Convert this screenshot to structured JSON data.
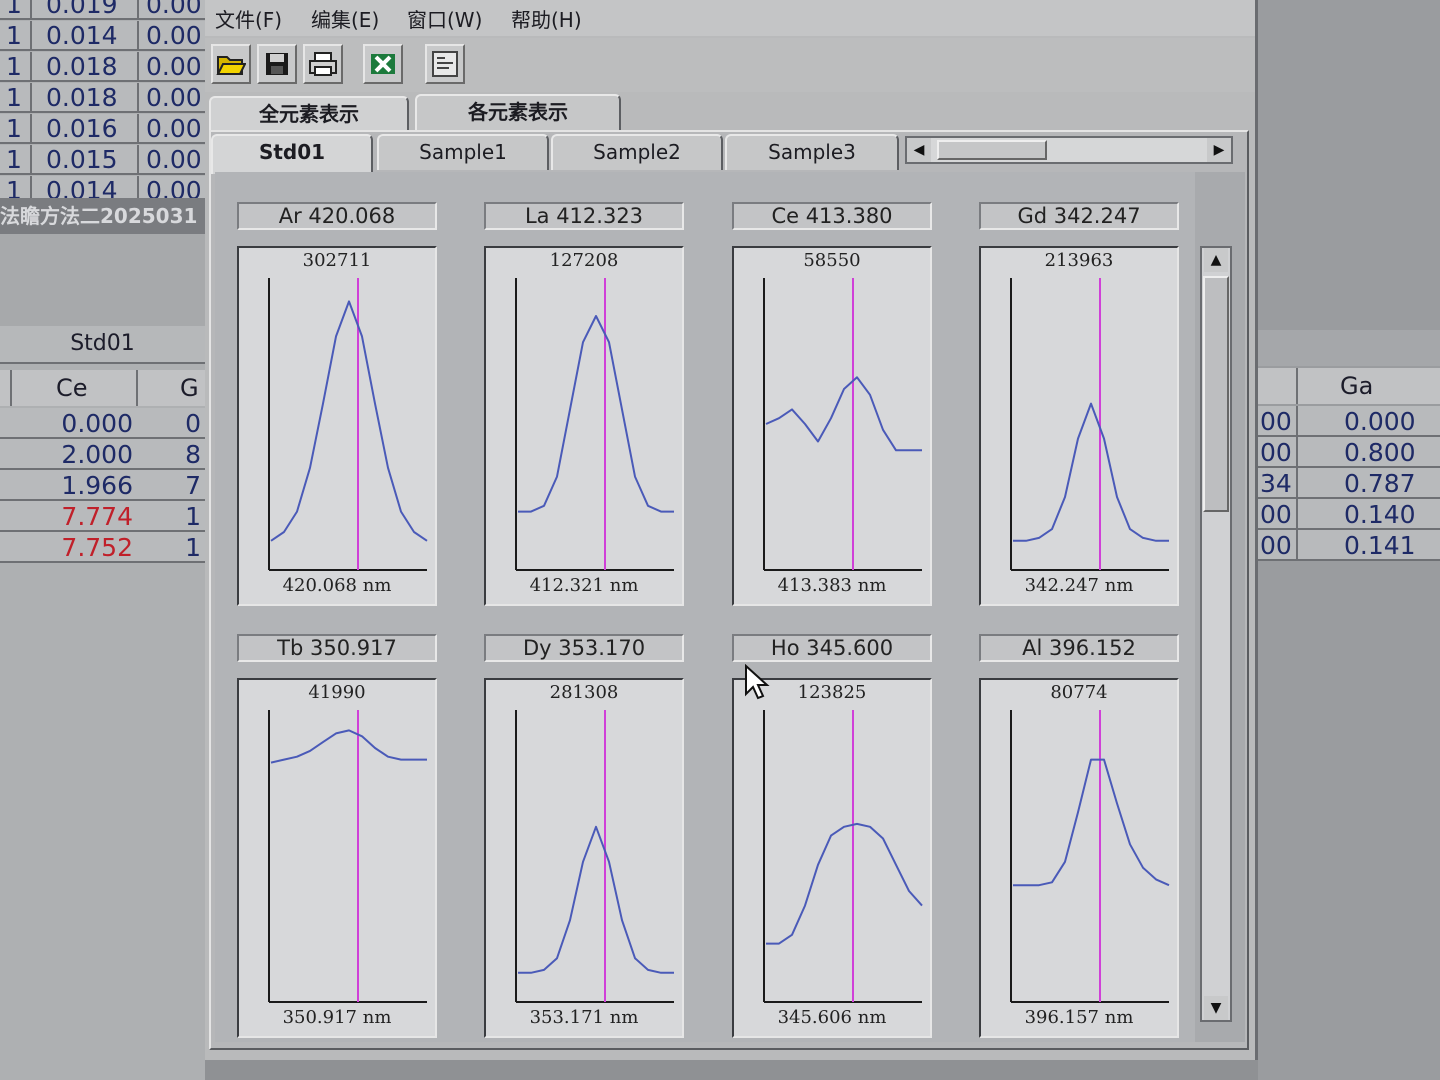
{
  "menu": {
    "file": "文件(F)",
    "edit": "编集(E)",
    "window": "窗口(W)",
    "help": "帮助(H)"
  },
  "outer_tabs": [
    "全元素表示",
    "各元素表示"
  ],
  "inner_tabs": [
    "Std01",
    "Sample1",
    "Sample2",
    "Sample3"
  ],
  "left_table": {
    "top_rows": [
      {
        "c0": "1",
        "c1": "0.019",
        "c2": "0.00"
      },
      {
        "c0": "1",
        "c1": "0.014",
        "c2": "0.00"
      },
      {
        "c0": "1",
        "c1": "0.018",
        "c2": "0.00"
      },
      {
        "c0": "1",
        "c1": "0.018",
        "c2": "0.00"
      },
      {
        "c0": "1",
        "c1": "0.016",
        "c2": "0.00"
      },
      {
        "c0": "1",
        "c1": "0.015",
        "c2": "0.00"
      },
      {
        "c0": "1",
        "c1": "0.014",
        "c2": "0.00"
      }
    ],
    "window_title": "法瞻方法二2025031",
    "std_label": "Std01",
    "col_ce": "Ce",
    "col_next": "G",
    "values": [
      {
        "v": "0.000",
        "r": "0"
      },
      {
        "v": "2.000",
        "r": "8"
      },
      {
        "v": "1.966",
        "r": "7"
      },
      {
        "v": "7.774",
        "r": "1"
      },
      {
        "v": "7.752",
        "r": "1"
      }
    ]
  },
  "right_table": {
    "col_ga": "Ga",
    "rows": [
      {
        "a": "00",
        "b": "0.000"
      },
      {
        "a": "00",
        "b": "0.800"
      },
      {
        "a": "34",
        "b": "0.787"
      },
      {
        "a": "00",
        "b": "0.140"
      },
      {
        "a": "00",
        "b": "0.141"
      }
    ]
  },
  "chart_data": [
    {
      "type": "line",
      "title": "Ar 420.068",
      "peak_intensity": "302711",
      "center": "420.068 nm",
      "y": [
        0.1,
        0.13,
        0.2,
        0.35,
        0.57,
        0.8,
        0.92,
        0.8,
        0.57,
        0.35,
        0.2,
        0.13,
        0.1
      ],
      "shape": "gauss"
    },
    {
      "type": "line",
      "title": "La 412.323",
      "peak_intensity": "127208",
      "center": "412.321 nm",
      "y": [
        0.2,
        0.2,
        0.22,
        0.32,
        0.55,
        0.78,
        0.87,
        0.78,
        0.55,
        0.32,
        0.22,
        0.2,
        0.2
      ],
      "shape": "gauss"
    },
    {
      "type": "line",
      "title": "Ce 413.380",
      "peak_intensity": "58550",
      "center": "413.383 nm",
      "y": [
        0.5,
        0.52,
        0.55,
        0.5,
        0.44,
        0.52,
        0.62,
        0.66,
        0.6,
        0.48,
        0.41,
        0.41,
        0.41
      ],
      "shape": "double"
    },
    {
      "type": "line",
      "title": "Gd 342.247",
      "peak_intensity": "213963",
      "center": "342.247 nm",
      "y": [
        0.1,
        0.1,
        0.11,
        0.14,
        0.25,
        0.45,
        0.57,
        0.45,
        0.25,
        0.14,
        0.11,
        0.1,
        0.1
      ],
      "shape": "gauss"
    },
    {
      "type": "line",
      "title": "Tb 350.917",
      "peak_intensity": "41990",
      "center": "350.917 nm",
      "y": [
        0.82,
        0.83,
        0.84,
        0.86,
        0.89,
        0.92,
        0.93,
        0.91,
        0.87,
        0.84,
        0.83,
        0.83,
        0.83
      ],
      "shape": "broad"
    },
    {
      "type": "line",
      "title": "Dy 353.170",
      "peak_intensity": "281308",
      "center": "353.171 nm",
      "y": [
        0.1,
        0.1,
        0.11,
        0.15,
        0.28,
        0.48,
        0.6,
        0.48,
        0.28,
        0.15,
        0.11,
        0.1,
        0.1
      ],
      "shape": "gauss"
    },
    {
      "type": "line",
      "title": "Ho 345.600",
      "peak_intensity": "123825",
      "center": "345.606 nm",
      "y": [
        0.2,
        0.2,
        0.23,
        0.33,
        0.47,
        0.57,
        0.6,
        0.61,
        0.6,
        0.56,
        0.47,
        0.38,
        0.33
      ],
      "shape": "broad"
    },
    {
      "type": "line",
      "title": "Al 396.152",
      "peak_intensity": "80774",
      "center": "396.157 nm",
      "y": [
        0.4,
        0.4,
        0.4,
        0.41,
        0.48,
        0.65,
        0.83,
        0.83,
        0.68,
        0.54,
        0.46,
        0.42,
        0.4
      ],
      "shape": "gauss"
    }
  ]
}
